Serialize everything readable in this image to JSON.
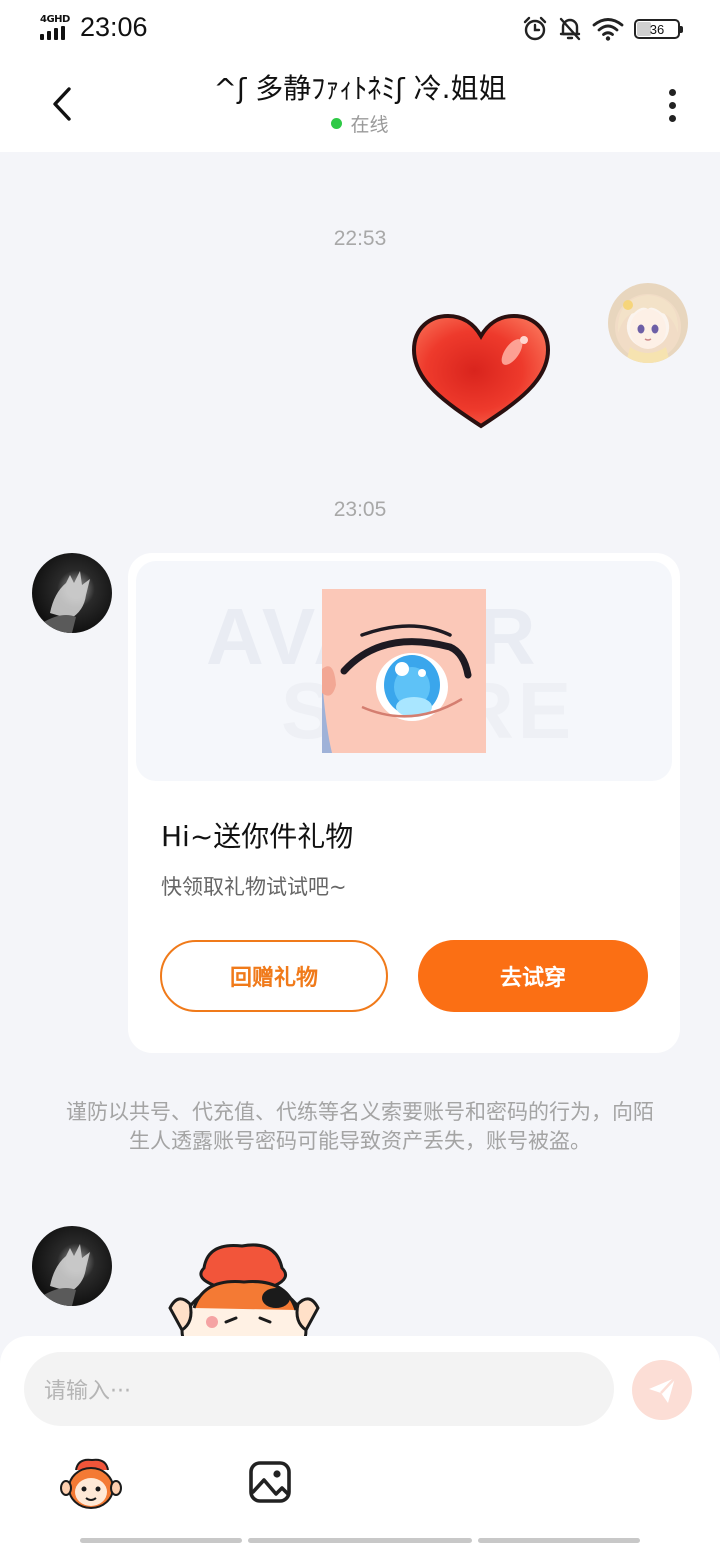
{
  "status_bar": {
    "network": "4GHD",
    "time": "23:06",
    "battery": "36"
  },
  "header": {
    "title": "^ʃ 多静ﾌｧｨﾄﾈﾐʃ 冷.姐姐",
    "status": "在线"
  },
  "messages": [
    {
      "type": "timestamp",
      "text": "22:53"
    },
    {
      "type": "sticker",
      "from": "self",
      "content": "heart"
    },
    {
      "type": "timestamp",
      "text": "23:05"
    },
    {
      "type": "gift_card",
      "from": "other",
      "image_watermark": [
        "AVATAR",
        "STORE"
      ],
      "title": "Hi~送你件礼物",
      "subtitle": "快领取礼物试试吧~",
      "button_secondary": "回赠礼物",
      "button_primary": "去试穿"
    },
    {
      "type": "notice",
      "text": "谨防以共号、代充值、代练等名义索要账号和密码的行为，向陌生人透露账号密码可能导致资产丢失，账号被盗。"
    },
    {
      "type": "sticker",
      "from": "other",
      "content": "monkey-with-heart"
    }
  ],
  "composer": {
    "placeholder": "请输入···",
    "tools": [
      "monkey-sticker-icon",
      "image-icon"
    ]
  },
  "colors": {
    "accent": "#fb6f14",
    "online": "#2ec946",
    "background": "#f4f5f9"
  }
}
